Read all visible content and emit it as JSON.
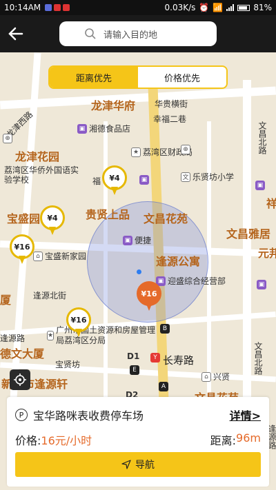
{
  "status_bar": {
    "time": "10:14AM",
    "net_speed": "0.03K/s",
    "battery": "81%"
  },
  "top_bar": {
    "search_placeholder": "请输入目的地"
  },
  "sort_toggle": {
    "options": [
      {
        "label": "距离优先",
        "active": true
      },
      {
        "label": "价格优先",
        "active": false
      }
    ]
  },
  "map": {
    "area_labels": [
      "龙津华府",
      "龙津花园",
      "宝盛园",
      "文昌花苑",
      "逢源公寓",
      "文昌雅居",
      "厦",
      "德文大厦",
      "新城市逢源轩",
      "文昌花苑",
      "元邦",
      "祥"
    ],
    "street_labels": [
      "龙津西路",
      "华贵横街",
      "幸福二巷",
      "文昌北路",
      "文昌北路",
      "逢源北街",
      "宝贤坊",
      "长寿路",
      "逢源路",
      "逢源路"
    ],
    "pois": [
      {
        "name": "湘德食品店",
        "icon": "shop-icon"
      },
      {
        "name": "荔湾区财政局",
        "icon": "government-icon"
      },
      {
        "name": "荔湾区华侨外国语实验学校",
        "icon": "school-icon"
      },
      {
        "name": "乐贤坊小学",
        "icon": "school-icon"
      },
      {
        "name": "福",
        "icon": "shop-icon"
      },
      {
        "name": "贵贤上品",
        "icon": "building-icon"
      },
      {
        "name": "宝盛新家园",
        "icon": "home-icon"
      },
      {
        "name": "便捷",
        "icon": "shop-icon"
      },
      {
        "name": "迎盛综合经营部",
        "icon": "shop-icon"
      },
      {
        "name": "广州市国土资源和房屋管理局荔湾区分局",
        "icon": "government-icon"
      },
      {
        "name": "兴贤",
        "icon": "home-icon"
      }
    ],
    "price_pins": [
      {
        "label": "¥4",
        "selected": false
      },
      {
        "label": "¥4",
        "selected": false
      },
      {
        "label": "¥16",
        "selected": false
      },
      {
        "label": "¥16",
        "selected": true
      },
      {
        "label": "¥16",
        "selected": false
      }
    ],
    "metro_labels": [
      "B",
      "D1",
      "E",
      "D2",
      "A"
    ],
    "metro_station": "长寿路"
  },
  "card": {
    "title": "宝华路咪表收费停车场",
    "detail_label": "详情>",
    "price_label": "价格:",
    "price_value": "16元/小时",
    "distance_label": "距离:",
    "distance_value": "96m",
    "nav_label": "导航"
  },
  "colors": {
    "accent": "#f5c518",
    "selected_pin": "#e56a2a",
    "radius_fill": "#788cdc"
  }
}
